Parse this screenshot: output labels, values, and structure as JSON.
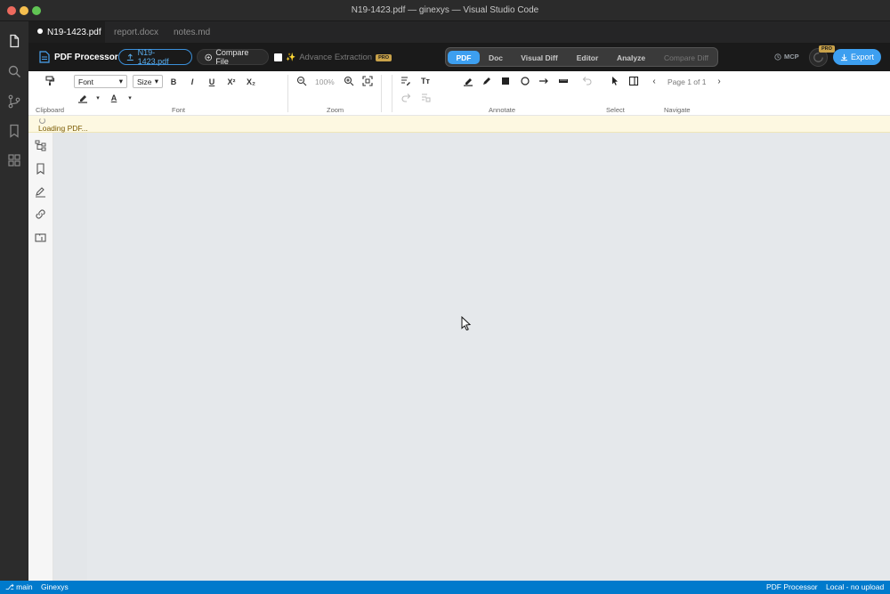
{
  "window": {
    "title": "N19-1423.pdf — ginexys — Visual Studio Code"
  },
  "tabs": [
    {
      "label": "N19-1423.pdf",
      "active": true
    },
    {
      "label": "report.docx",
      "active": false
    },
    {
      "label": "notes.md",
      "active": false
    }
  ],
  "header": {
    "brand": "PDF Processor",
    "file_button": "N19-1423.pdf",
    "compare_button": "Compare File",
    "advance_extraction": "Advance Extraction",
    "pro_badge": "PRO",
    "modes": [
      "PDF",
      "Doc",
      "Visual Diff",
      "Editor",
      "Analyze",
      "Compare Diff"
    ],
    "active_mode": "PDF",
    "mcp": "MCP",
    "export": "Export"
  },
  "ribbon": {
    "font_select": "Font",
    "size_select": "Size",
    "zoom_value": "100%",
    "page_indicator": "Page 1 of 1",
    "groups": {
      "clipboard": "Clipboard",
      "font": "Font",
      "zoom": "Zoom",
      "annotate": "Annotate",
      "select": "Select",
      "navigate": "Navigate"
    },
    "font_buttons": [
      "B",
      "I",
      "U",
      "X²",
      "X₂"
    ]
  },
  "loading": {
    "text": "Loading PDF..."
  },
  "statusbar": {
    "branch": "main",
    "workspace": "Ginexys",
    "app": "PDF Processor",
    "upload": "Local - no upload"
  },
  "colors": {
    "accent": "#3d9ff0",
    "status_bar": "#007acc",
    "pro_badge": "#c9a24a",
    "loading_bg": "#fdf8e1"
  }
}
